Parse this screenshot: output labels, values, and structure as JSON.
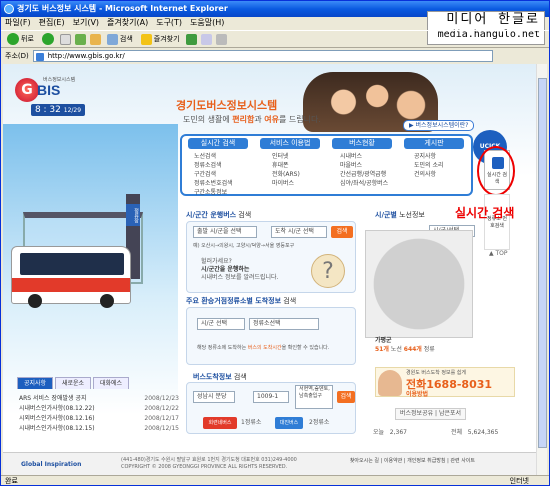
{
  "window": {
    "title": "경기도 버스정보 시스템 - Microsoft Internet Explorer"
  },
  "watermark": {
    "line1": "미디어 한글로",
    "line2": "media.hangulo.net"
  },
  "menu": [
    "파일(F)",
    "편집(E)",
    "보기(V)",
    "즐겨찾기(A)",
    "도구(T)",
    "도움말(H)"
  ],
  "toolbar": {
    "back": "뒤로",
    "search": "검색",
    "favorites": "즐겨찾기"
  },
  "address": {
    "label": "주소(D)",
    "url": "http://www.gbis.go.kr/"
  },
  "status": {
    "left": "완료",
    "zone": "인터넷"
  },
  "site": {
    "logo_small": "버스정보시스템",
    "logo_g": "G",
    "logo_bis": "BIS",
    "clock_time": "8 : 32",
    "clock_date": "12/29",
    "headline": "경기도버스정보시스템",
    "sub_pre": "도민의 생활에 ",
    "sub_b1": "편리함",
    "sub_mid": "과 ",
    "sub_b2": "여유",
    "sub_post": "를 드립니다.",
    "intro": "▶ 버스정보시스템이란?",
    "bus_sign": "정류장"
  },
  "nav": {
    "cols": [
      {
        "head": "실시간 검색",
        "items": [
          "노선검색",
          "정류소검색",
          "구간검색",
          "정류소번호검색",
          "구간소통정보"
        ]
      },
      {
        "head": "서비스 이용법",
        "items": [
          "인터넷",
          "휴대폰",
          "전화(ARS)",
          "마이버스"
        ]
      },
      {
        "head": "버스현황",
        "items": [
          "시내버스",
          "마을버스",
          "간선급행/광역급행",
          "심야/좌석/공항버스"
        ]
      },
      {
        "head": "게시판",
        "items": [
          "공지사항",
          "도민의 소리",
          "건의사항"
        ]
      }
    ]
  },
  "side": {
    "ucick": "UCICK",
    "realtime": "실시간 검색",
    "second": "정류소 번호검색",
    "top": "▲ TOP",
    "note": "실시간 검색"
  },
  "route_search": {
    "title": "시/군간 운행버스",
    "title_suffix": " 검색",
    "from": "출발 시/군을 선택",
    "to": "도착 시/군 선택",
    "btn": "검색",
    "example": "예) 오산시→의왕시, 고양시/덕양→서울 영등포구",
    "help1": "헐러가세요?",
    "help2": "시/군간을 운행하는",
    "help3": "시내버스 정보를 알려드립니다."
  },
  "transfer_search": {
    "title": "주요 환승거점정류소별 도착정보",
    "title_suffix": " 검색",
    "sel1": "시/군 선택",
    "sel2": "정류소선택",
    "msg_pre": "해당 정류소에 도착하는 ",
    "msg_hl": "버스의 도착시간",
    "msg_post": "을 확인할 수 있습니다."
  },
  "stop_search": {
    "title": "버스도착정보",
    "title_suffix": " 검색",
    "sel1": "성남시 분당",
    "sel2": "1009-1",
    "sel3": "서현역,숲덴토,남측출입구",
    "btn": "검색",
    "b1": "회련네버스",
    "t1": "1정류소",
    "b2": "대진버스",
    "t2": "2정류소"
  },
  "map": {
    "title": "시/군별",
    "title_suffix": " 노선정보",
    "select": "시/군/선택",
    "city": "가평군",
    "routes_label": "노선",
    "routes": "51개",
    "stops_label": "정류",
    "stops": "644개"
  },
  "call": {
    "top": "경원도 버스도착 정보를 쉽게",
    "phone": "전화1688-8031",
    "use": "이용방법"
  },
  "links": {
    "share": "버스정보공유 | 남은포서"
  },
  "stats": {
    "today_label": "오늘",
    "today": "2,367",
    "total_label": "전체",
    "total": "5,624,365"
  },
  "news": {
    "tabs": [
      "공지사항",
      "새로운소",
      "대화에스"
    ],
    "items": [
      {
        "t": "ARS 서비스 장애발생 공지",
        "d": "2008/12/23"
      },
      {
        "t": "시내버스인가사항(08.12.22)",
        "d": "2008/12/22"
      },
      {
        "t": "시외버스인가사항(08.12.16)",
        "d": "2008/12/17"
      },
      {
        "t": "시내버스인가사항(08.12.15)",
        "d": "2008/12/15"
      }
    ]
  },
  "footer": {
    "gi": "Global Inspiration",
    "addr1": "(441-480)경기도 수원시 팔달구 효원로 1번지 경기도청 대표번호 031)249-4000",
    "addr2": "COPYRIGHT © 2008 GYEONGGI PROVINCE ALL RIGHTS RESERVED.",
    "links": "찾아오시는 길 | 이용약관 | 개인정보 취급방침 | 관련 사이트"
  }
}
